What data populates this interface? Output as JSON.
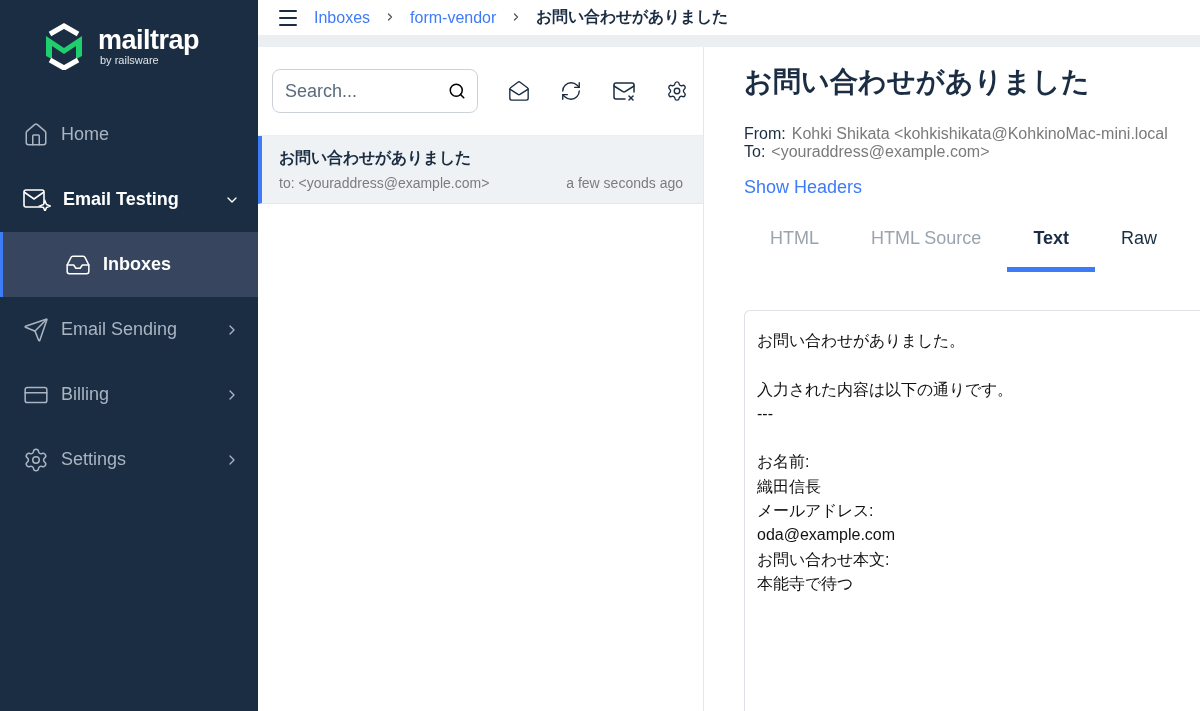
{
  "brand": {
    "name": "mailtrap",
    "tagline": "by railsware"
  },
  "sidebar": {
    "items": [
      {
        "label": "Home",
        "kind": "plain",
        "selected": false
      },
      {
        "label": "Email Testing",
        "kind": "group",
        "expanded": true,
        "selected": false,
        "children": [
          {
            "label": "Inboxes",
            "selected": true
          }
        ]
      },
      {
        "label": "Email Sending",
        "kind": "group",
        "expanded": false,
        "selected": false
      },
      {
        "label": "Billing",
        "kind": "group",
        "expanded": false,
        "selected": false
      },
      {
        "label": "Settings",
        "kind": "group",
        "expanded": false,
        "selected": false
      }
    ]
  },
  "breadcrumb": [
    {
      "label": "Inboxes",
      "kind": "link"
    },
    {
      "label": "form-vendor",
      "kind": "link"
    },
    {
      "label": "お問い合わせがありました",
      "kind": "current"
    }
  ],
  "search": {
    "placeholder": "Search..."
  },
  "messages": [
    {
      "subject": "お問い合わせがありました",
      "to": "to: <youraddress@example.com>",
      "time": "a few seconds ago",
      "selected": true
    }
  ],
  "message": {
    "subject": "お問い合わせがありました",
    "from_label": "From:",
    "from": "Kohki Shikata <kohkishikata@KohkinoMac-mini.local",
    "to_label": "To:",
    "to": "<youraddress@example.com>",
    "show_headers": "Show Headers",
    "tabs": [
      {
        "label": "HTML",
        "selected": false,
        "disabled": true
      },
      {
        "label": "HTML Source",
        "selected": false,
        "disabled": true
      },
      {
        "label": "Text",
        "selected": true,
        "disabled": false
      },
      {
        "label": "Raw",
        "selected": false,
        "disabled": false
      }
    ],
    "body": [
      [
        "お問い合わせがありました。"
      ],
      [
        "入力された内容は以下の通りです。",
        "---"
      ],
      [
        "お名前:",
        "織田信長",
        "メールアドレス:",
        "oda@example.com",
        "お問い合わせ本文:",
        "本能寺で待つ"
      ]
    ]
  }
}
